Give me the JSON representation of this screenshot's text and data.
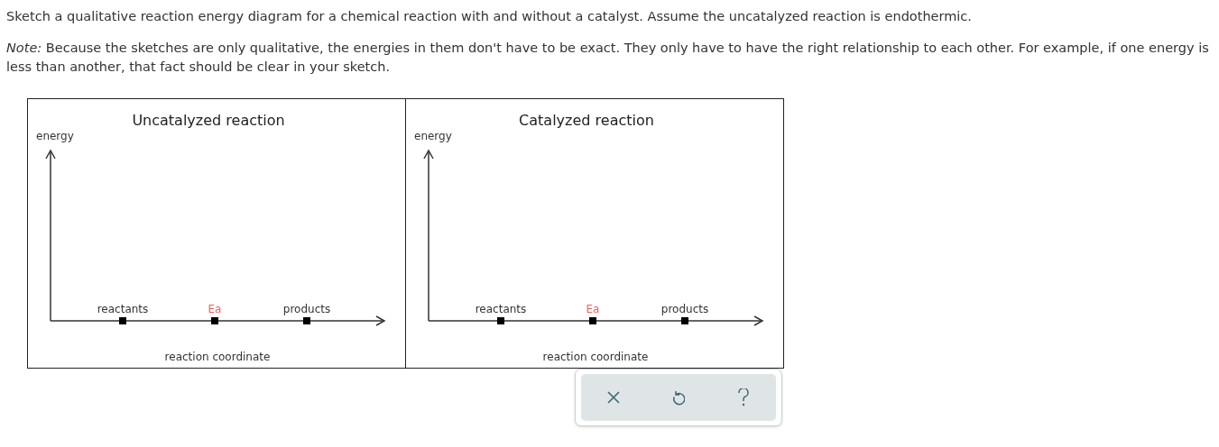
{
  "question": "Sketch a qualitative reaction energy diagram for a chemical reaction with and without a catalyst. Assume the uncatalyzed reaction is endothermic.",
  "note": "*Note:* Because the sketches are only qualitative, the energies in them don't have to be exact. They only have to have the right relationship to each other. For example, if one energy is less than another, that fact should be clear in your sketch.",
  "panels": [
    {
      "title": "Uncatalyzed reaction",
      "y_label": "energy",
      "x_label": "reaction coordinate",
      "ticks": [
        {
          "label": "reactants",
          "kind": "state"
        },
        {
          "label": "Ea",
          "kind": "activation"
        },
        {
          "label": "products",
          "kind": "state"
        }
      ]
    },
    {
      "title": "Catalyzed reaction",
      "y_label": "energy",
      "x_label": "reaction coordinate",
      "ticks": [
        {
          "label": "reactants",
          "kind": "state"
        },
        {
          "label": "Ea",
          "kind": "activation"
        },
        {
          "label": "products",
          "kind": "state"
        }
      ]
    }
  ]
}
